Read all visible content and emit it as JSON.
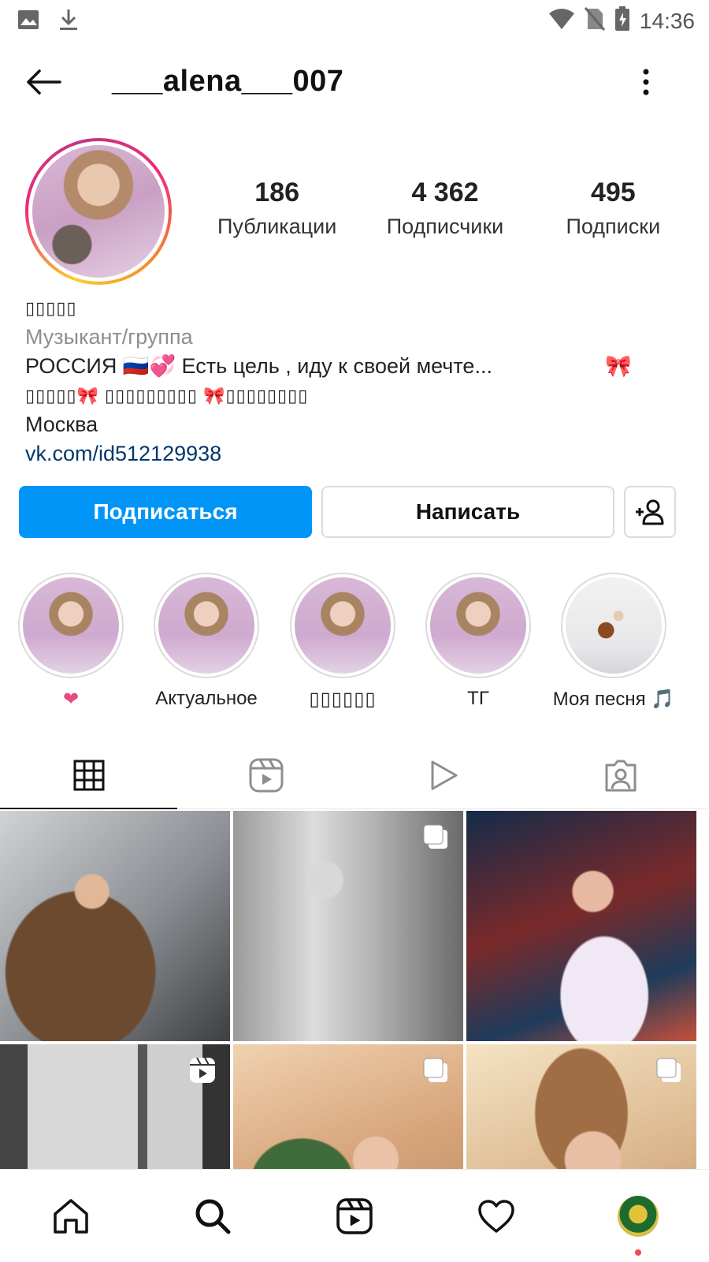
{
  "status_bar": {
    "time": "14:36"
  },
  "header": {
    "username": "___alena___007"
  },
  "profile": {
    "stats": [
      {
        "value": "186",
        "label": "Публикации"
      },
      {
        "value": "4 362",
        "label": "Подписчики"
      },
      {
        "value": "495",
        "label": "Подписки"
      }
    ],
    "display_name": "▯▯▯▯▯",
    "category": "Музыкант/группа",
    "bio_line1": "РОССИЯ 🇷🇺💞 Есть цель , иду к своей мечте...",
    "bio_line1_end": "🎀",
    "bio_line2": "▯▯▯▯▯🎀 ▯▯▯▯▯▯▯▯▯ 🎀▯▯▯▯▯▯▯▯",
    "city": "Москва",
    "link": "vk.com/id512129938"
  },
  "actions": {
    "follow_label": "Подписаться",
    "message_label": "Написать"
  },
  "highlights": [
    {
      "label": "❤"
    },
    {
      "label": "Актуальное"
    },
    {
      "label": "▯▯▯▯▯▯"
    },
    {
      "label": "ТГ"
    },
    {
      "label": "Моя песня 🎵"
    }
  ],
  "colors": {
    "primary_button": "#0095f6",
    "link": "#00376b",
    "notification_dot": "#ed4956"
  }
}
